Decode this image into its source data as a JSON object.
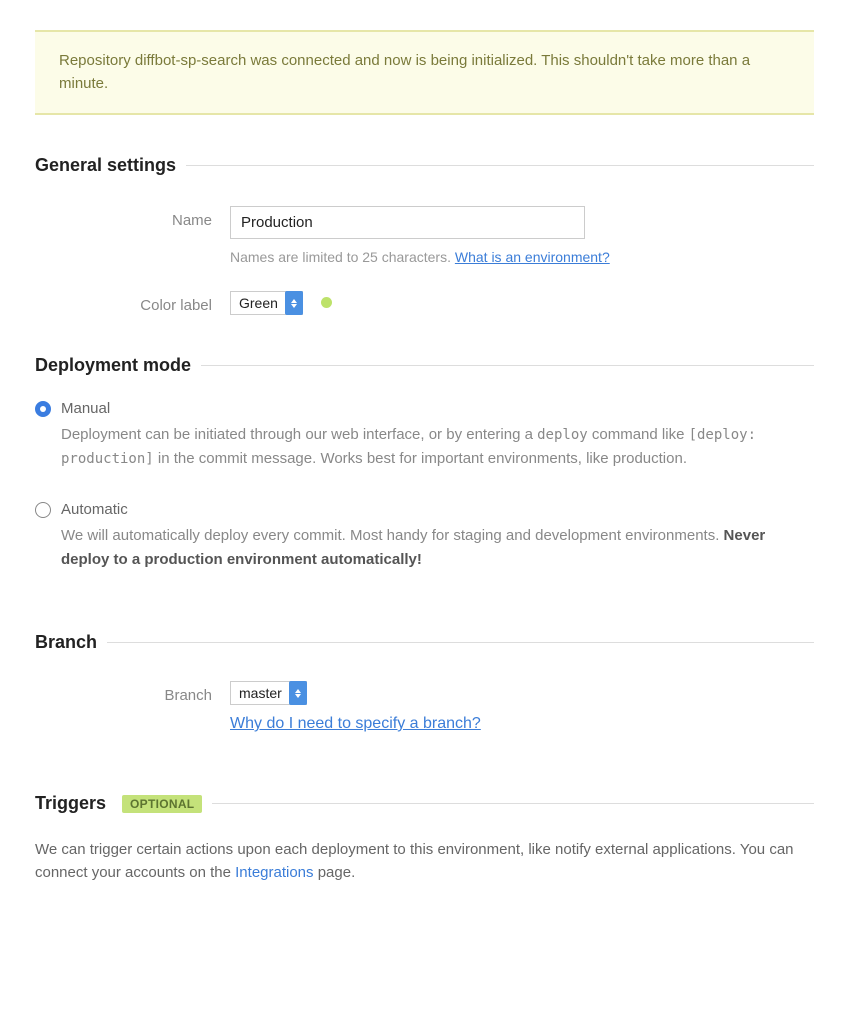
{
  "alert": {
    "message": "Repository diffbot-sp-search was connected and now is being initialized. This shouldn't take more than a minute."
  },
  "general": {
    "heading": "General settings",
    "name_label": "Name",
    "name_value": "Production",
    "name_help": "Names are limited to 25 characters.",
    "name_help_link": "What is an environment?",
    "color_label": "Color label",
    "color_selected": "Green",
    "color_hex": "#bde26a"
  },
  "deployment": {
    "heading": "Deployment mode",
    "options": [
      {
        "label": "Manual",
        "checked": true,
        "desc_pre": "Deployment can be initiated through our web interface, or by entering a ",
        "desc_code1": "deploy",
        "desc_mid": " command like ",
        "desc_code2": "[deploy: production]",
        "desc_post": " in the commit message. Works best for important environments, like production."
      },
      {
        "label": "Automatic",
        "checked": false,
        "desc": "We will automatically deploy every commit. Most handy for staging and development environments. ",
        "desc_bold": "Never deploy to a production environment automatically!"
      }
    ]
  },
  "branch": {
    "heading": "Branch",
    "label": "Branch",
    "selected": "master",
    "help_link": "Why do I need to specify a branch?"
  },
  "triggers": {
    "heading": "Triggers",
    "badge": "OPTIONAL",
    "text_pre": "We can trigger certain actions upon each deployment to this environment, like notify external applications. You can connect your accounts on the ",
    "link": "Integrations",
    "text_post": " page."
  }
}
